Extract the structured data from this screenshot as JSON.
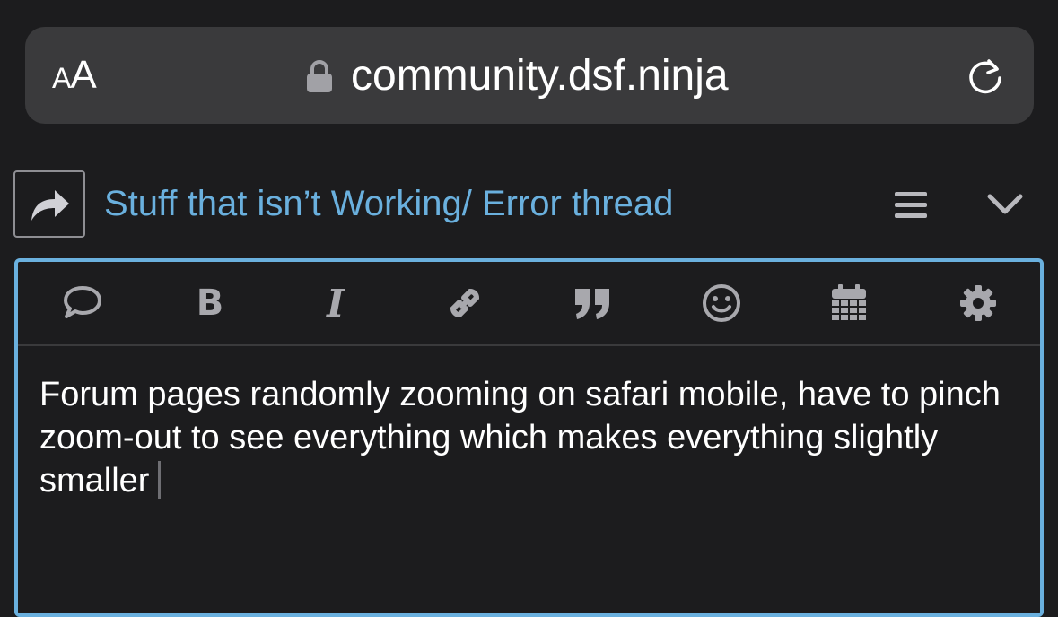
{
  "browser": {
    "text_size_label_small": "A",
    "text_size_label_large": "A",
    "url": "community.dsf.ninja",
    "icons": [
      "lock-icon",
      "reload-icon"
    ]
  },
  "topic": {
    "title": "Stuff that isn’t Working/ Error thread",
    "title_color": "#6ab0de",
    "icons": [
      "reply-arrow-icon",
      "hamburger-menu-icon",
      "chevron-down-icon"
    ]
  },
  "composer": {
    "border_color": "#6ab0de",
    "toolbar": [
      "speech-bubble-icon",
      "bold-icon",
      "italic-icon",
      "link-icon",
      "quote-icon",
      "smiley-icon",
      "calendar-icon",
      "gear-icon"
    ],
    "bold_glyph": "B",
    "italic_glyph": "I",
    "body_text": "Forum pages randomly zooming on safari mobile, have to pinch zoom-out to see everything which makes everything slightly smaller"
  }
}
